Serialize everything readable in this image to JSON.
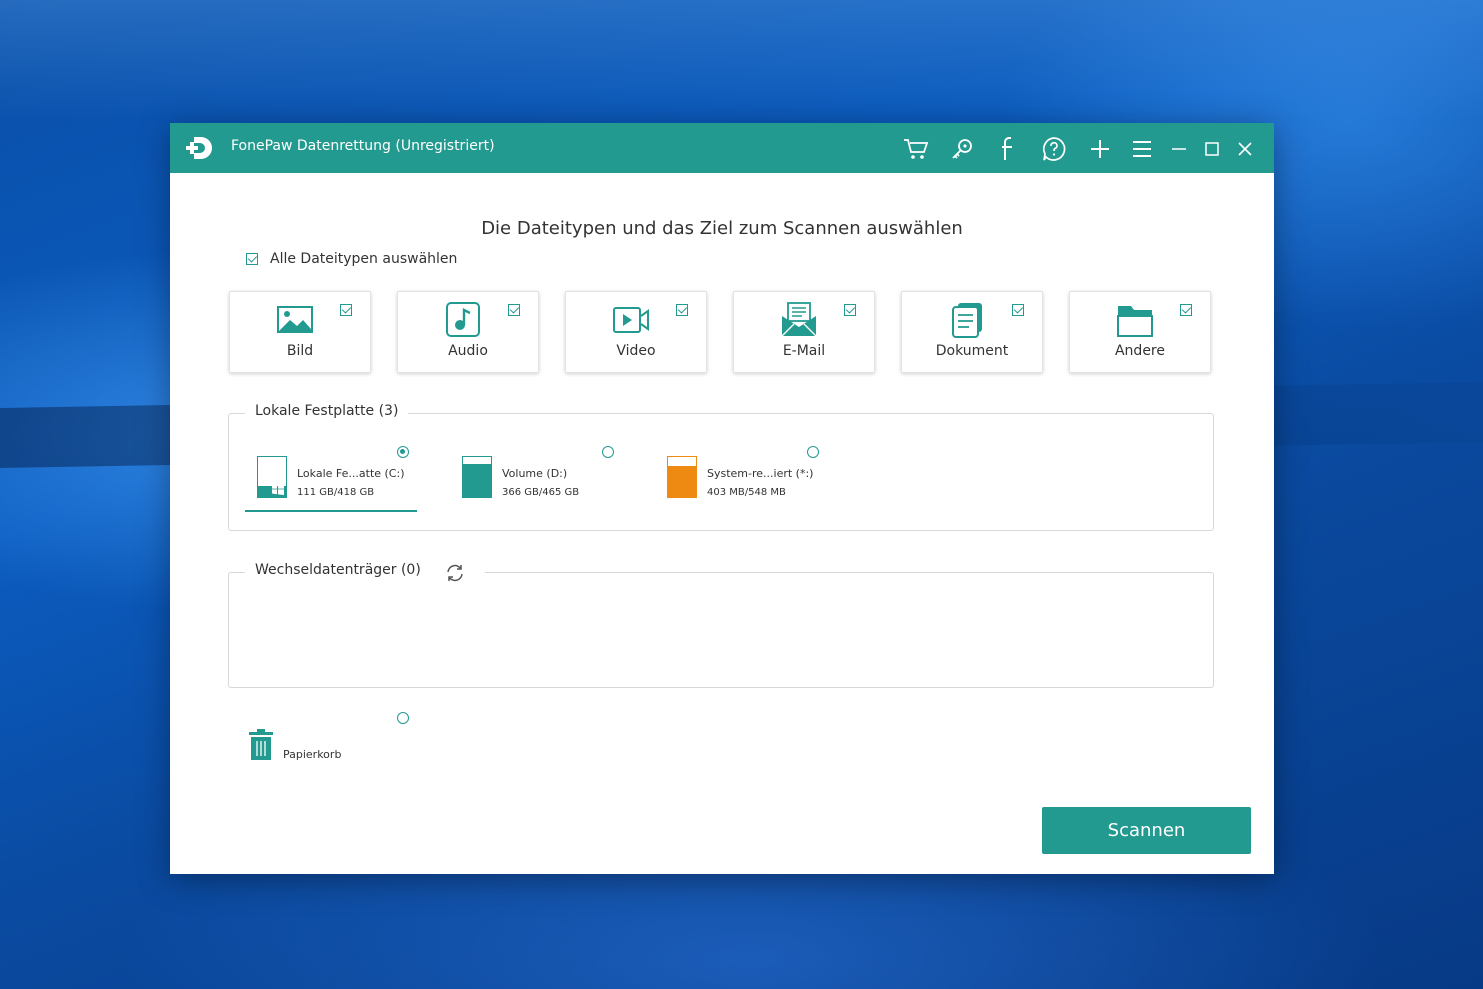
{
  "app": {
    "title": "FonePaw Datenrettung (Unregistriert)",
    "logo_icon": "fonepaw-logo-icon"
  },
  "titlebar": {
    "icons": [
      "cart-icon",
      "key-icon",
      "facebook-icon",
      "help-icon",
      "plus-icon",
      "menu-icon",
      "minimize-icon",
      "maximize-icon",
      "close-icon"
    ]
  },
  "main": {
    "heading": "Die Dateitypen und das Ziel zum Scannen auswählen",
    "select_all_label": "Alle Dateitypen auswählen",
    "select_all_checked": true,
    "file_types": [
      {
        "label": "Bild",
        "icon": "image-icon",
        "checked": true
      },
      {
        "label": "Audio",
        "icon": "audio-icon",
        "checked": true
      },
      {
        "label": "Video",
        "icon": "video-icon",
        "checked": true
      },
      {
        "label": "E-Mail",
        "icon": "email-icon",
        "checked": true
      },
      {
        "label": "Dokument",
        "icon": "document-icon",
        "checked": true
      },
      {
        "label": "Andere",
        "icon": "folder-icon",
        "checked": true
      }
    ]
  },
  "local_disk": {
    "title": "Lokale Festplatte (3)",
    "drives": [
      {
        "name": "Lokale Fe...atte (C:)",
        "size": "111 GB/418 GB",
        "used_fraction": 0.27,
        "selected": true,
        "color": "#239a8f"
      },
      {
        "name": "Volume (D:)",
        "size": "366 GB/465 GB",
        "used_fraction": 0.79,
        "selected": false,
        "color": "#239a8f"
      },
      {
        "name": "System-re...iert (*:)",
        "size": "403 MB/548 MB",
        "used_fraction": 0.74,
        "selected": false,
        "color": "#ee8a12"
      }
    ]
  },
  "removable": {
    "title": "Wechseldatenträger (0)",
    "refresh_icon": "refresh-icon"
  },
  "recycle_bin": {
    "label": "Papierkorb",
    "icon": "trash-icon",
    "selected": false
  },
  "actions": {
    "scan_label": "Scannen"
  },
  "colors": {
    "accent": "#239a8f",
    "system_drive": "#ee8a12"
  }
}
